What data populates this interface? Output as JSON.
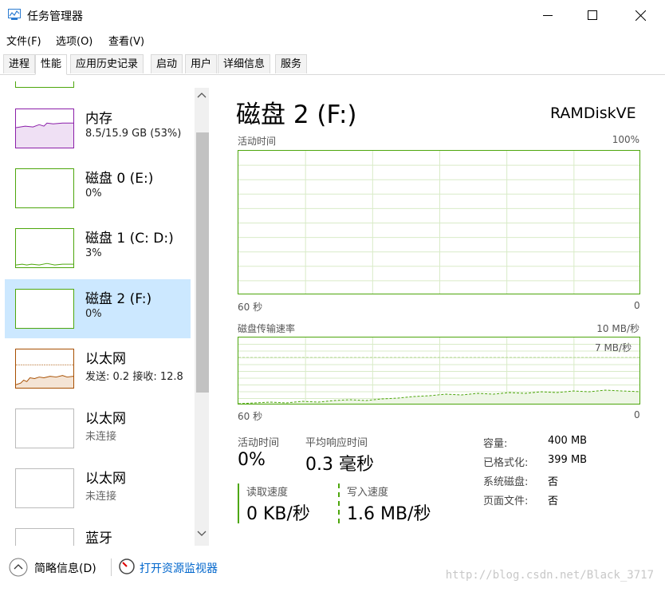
{
  "window": {
    "title": "任务管理器",
    "minimize_icon": "minimize-icon",
    "maximize_icon": "maximize-icon",
    "close_icon": "close-icon"
  },
  "menu": [
    "文件(F)",
    "选项(O)",
    "查看(V)"
  ],
  "tabs": [
    "进程",
    "性能",
    "应用历史记录",
    "启动",
    "用户",
    "详细信息",
    "服务"
  ],
  "active_tab": "性能",
  "resources": [
    {
      "name": "内存",
      "sub": "8.5/15.9 GB (53%)",
      "color": "#8b1fa9"
    },
    {
      "name": "磁盘 0 (E:)",
      "sub": "0%",
      "color": "#4da60c"
    },
    {
      "name": "磁盘 1 (C: D:)",
      "sub": "3%",
      "color": "#4da60c"
    },
    {
      "name": "磁盘 2 (F:)",
      "sub": "0%",
      "color": "#4da60c"
    },
    {
      "name": "以太网",
      "sub": "发送: 0.2 接收: 12.8",
      "color": "#a74f01"
    },
    {
      "name": "以太网",
      "sub": "未连接",
      "color": "#bbbbbb"
    },
    {
      "name": "以太网",
      "sub": "未连接",
      "color": "#bbbbbb"
    },
    {
      "name": "蓝牙",
      "sub": "",
      "color": "#bbbbbb"
    }
  ],
  "detail": {
    "title": "磁盘 2 (F:)",
    "model": "RAMDiskVE",
    "graph1": {
      "label": "活动时间",
      "max": "100%",
      "left": "60 秒",
      "right": "0"
    },
    "graph2": {
      "label": "磁盘传输速率",
      "max": "10 MB/秒",
      "inner": "7 MB/秒",
      "left": "60 秒",
      "right": "0"
    },
    "stats": {
      "active_label": "活动时间",
      "active_value": "0%",
      "resp_label": "平均响应时间",
      "resp_value": "0.3 毫秒",
      "read_label": "读取速度",
      "read_value": "0 KB/秒",
      "write_label": "写入速度",
      "write_value": "1.6 MB/秒"
    },
    "props": [
      {
        "label": "容量:",
        "value": "400 MB"
      },
      {
        "label": "已格式化:",
        "value": "399 MB"
      },
      {
        "label": "系统磁盘:",
        "value": "否"
      },
      {
        "label": "页面文件:",
        "value": "否"
      }
    ]
  },
  "bottom": {
    "summary": "简略信息(D)",
    "open_monitor": "打开资源监视器"
  },
  "watermark": "http://blog.csdn.net/Black_3717",
  "colors": {
    "disk": "#4da60c",
    "selected": "#cce8ff",
    "link": "#0066cc"
  }
}
